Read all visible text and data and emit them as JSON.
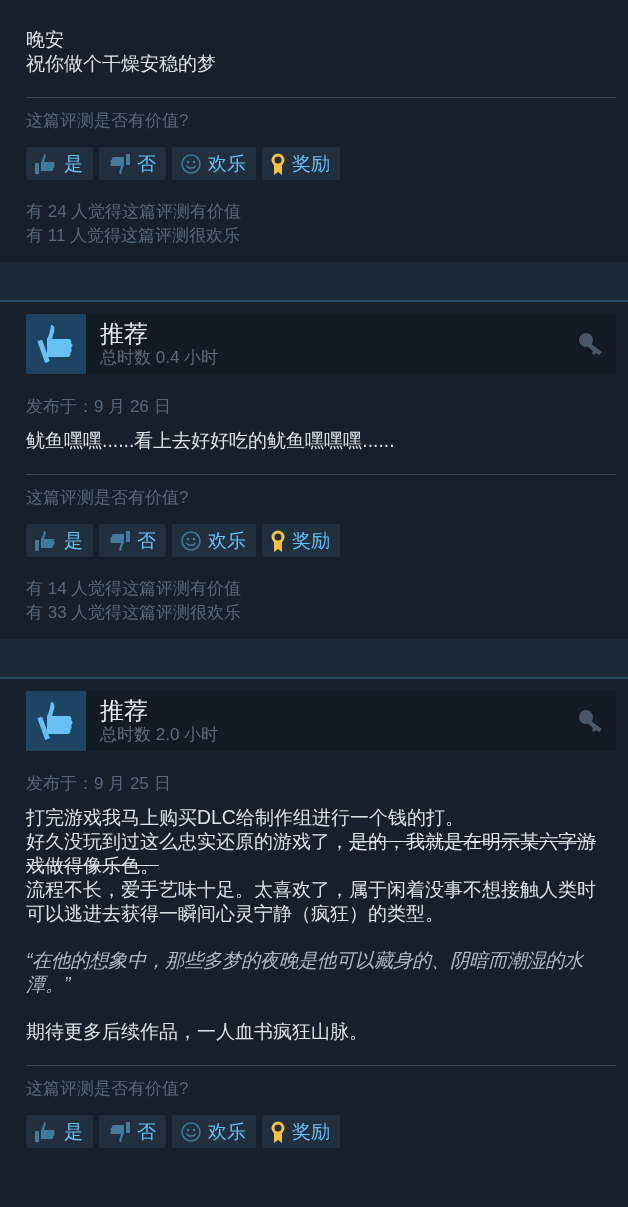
{
  "reviews": [
    {
      "paragraphs": [
        {
          "kind": "text",
          "lines": [
            {
              "segments": [
                {
                  "text": "晚安",
                  "strike": false
                }
              ]
            },
            {
              "segments": [
                {
                  "text": "祝你做个干燥安稳的梦",
                  "strike": false
                }
              ]
            }
          ]
        }
      ],
      "question": "这篇评测是否有价值?",
      "buttons": [
        {
          "kind": "yes",
          "label": "是"
        },
        {
          "kind": "no",
          "label": "否"
        },
        {
          "kind": "funny",
          "label": "欢乐"
        },
        {
          "kind": "award",
          "label": "奖励"
        }
      ],
      "counts": [
        "有 24 人觉得这篇评测有价值",
        "有 11 人觉得这篇评测很欢乐"
      ]
    },
    {
      "header": {
        "verdict": "推荐",
        "hours": "总时数 0.4 小时"
      },
      "date": "发布于：9 月 26 日",
      "paragraphs": [
        {
          "kind": "text",
          "lines": [
            {
              "segments": [
                {
                  "text": "鱿鱼嘿嘿......看上去好好吃的鱿鱼嘿嘿嘿......",
                  "strike": false
                }
              ]
            }
          ]
        }
      ],
      "question": "这篇评测是否有价值?",
      "buttons": [
        {
          "kind": "yes",
          "label": "是"
        },
        {
          "kind": "no",
          "label": "否"
        },
        {
          "kind": "funny",
          "label": "欢乐"
        },
        {
          "kind": "award",
          "label": "奖励"
        }
      ],
      "counts": [
        "有 14 人觉得这篇评测有价值",
        "有 33 人觉得这篇评测很欢乐"
      ]
    },
    {
      "header": {
        "verdict": "推荐",
        "hours": "总时数 2.0 小时"
      },
      "date": "发布于：9 月 25 日",
      "paragraphs": [
        {
          "kind": "text",
          "lines": [
            {
              "segments": [
                {
                  "text": "打完游戏我马上购买DLC给制作组进行一个钱的打。",
                  "strike": false
                }
              ]
            },
            {
              "segments": [
                {
                  "text": "好久没玩到过这么忠实还原的游戏了，",
                  "strike": false
                },
                {
                  "text": "是的，我就是在明示某六字游戏做得像乐色。",
                  "strike": true
                }
              ]
            },
            {
              "segments": [
                {
                  "text": "流程不长，爱手艺味十足。太喜欢了，属于闲着没事不想接触人类时可以逃进去获得一瞬间心灵宁静（疯狂）的类型。",
                  "strike": false
                }
              ]
            }
          ]
        },
        {
          "kind": "quote",
          "lines": [
            {
              "segments": [
                {
                  "text": "“在他的想象中，那些多梦的夜晚是他可以藏身的、阴暗而潮湿的水潭。”",
                  "strike": false
                }
              ]
            }
          ]
        },
        {
          "kind": "text",
          "lines": [
            {
              "segments": [
                {
                  "text": "期待更多后续作品，一人血书疯狂山脉。",
                  "strike": false
                }
              ]
            }
          ]
        }
      ],
      "question": "这篇评测是否有价值?",
      "buttons": [
        {
          "kind": "yes",
          "label": "是"
        },
        {
          "kind": "no",
          "label": "否"
        },
        {
          "kind": "funny",
          "label": "欢乐"
        },
        {
          "kind": "award",
          "label": "奖励"
        }
      ]
    }
  ]
}
